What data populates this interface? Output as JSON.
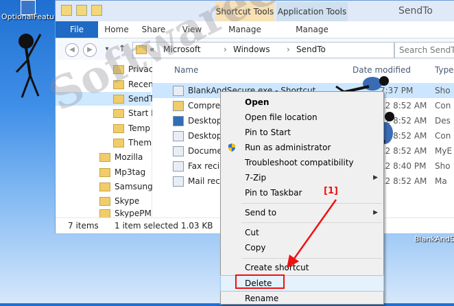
{
  "desktop": {
    "shortcut_label": "OptionalFeatures",
    "bottom_shortcut_label": "BlankAndSe"
  },
  "window": {
    "title": "SendTo",
    "contextual_tabs": [
      "Shortcut Tools",
      "Application Tools"
    ],
    "ribbon_tabs": [
      "File",
      "Home",
      "Share",
      "View",
      "Manage",
      "Manage"
    ]
  },
  "address": {
    "prefix": "«",
    "crumbs": [
      "Microsoft",
      "Windows",
      "SendTo"
    ],
    "search_placeholder": "Search SendTo"
  },
  "nav_pane": {
    "items": [
      "Privac",
      "Recen",
      "SendT",
      "Start M",
      "Temp",
      "Them",
      "Mozilla",
      "Mp3tag",
      "Samsung",
      "Skype",
      "SkypePM"
    ],
    "selected": "SendT"
  },
  "file_list": {
    "columns": [
      "Name",
      "Date modified",
      "Type"
    ],
    "rows": [
      {
        "name": "BlankAndSecure.exe - Shortcut",
        "date": "7:37 PM",
        "type": "Sho"
      },
      {
        "name": "Compres",
        "date": "12 8:52 AM",
        "type": "Con"
      },
      {
        "name": "Desktop",
        "date": "12 8:52 AM",
        "type": "Des"
      },
      {
        "name": "Desktop.",
        "date": "12 8:52 AM",
        "type": "Con"
      },
      {
        "name": "Docume",
        "date": "12 8:52 AM",
        "type": "MyE"
      },
      {
        "name": "Fax recip",
        "date": "12 8:40 PM",
        "type": "Sho"
      },
      {
        "name": "Mail reci",
        "date": "12 8:52 AM",
        "type": "Ma"
      }
    ]
  },
  "status_bar": {
    "count": "7 items",
    "selection": "1 item selected  1.03 KB"
  },
  "context_menu": {
    "items": [
      {
        "label": "Open",
        "bold": true
      },
      {
        "label": "Open file location"
      },
      {
        "label": "Pin to Start"
      },
      {
        "label": "Run as administrator",
        "icon": "uac-shield-icon"
      },
      {
        "label": "Troubleshoot compatibility"
      },
      {
        "label": "7-Zip",
        "submenu": true
      },
      {
        "label": "Pin to Taskbar"
      },
      {
        "label": "Send to",
        "submenu": true
      },
      {
        "label": "Cut"
      },
      {
        "label": "Copy"
      },
      {
        "label": "Create shortcut"
      },
      {
        "label": "Delete"
      },
      {
        "label": "Rename"
      }
    ],
    "submenu_arrow": "▶"
  },
  "annotation": {
    "marker": "[1]",
    "highlight_color": "#e11111"
  },
  "watermark": "SoftwareOK.com"
}
